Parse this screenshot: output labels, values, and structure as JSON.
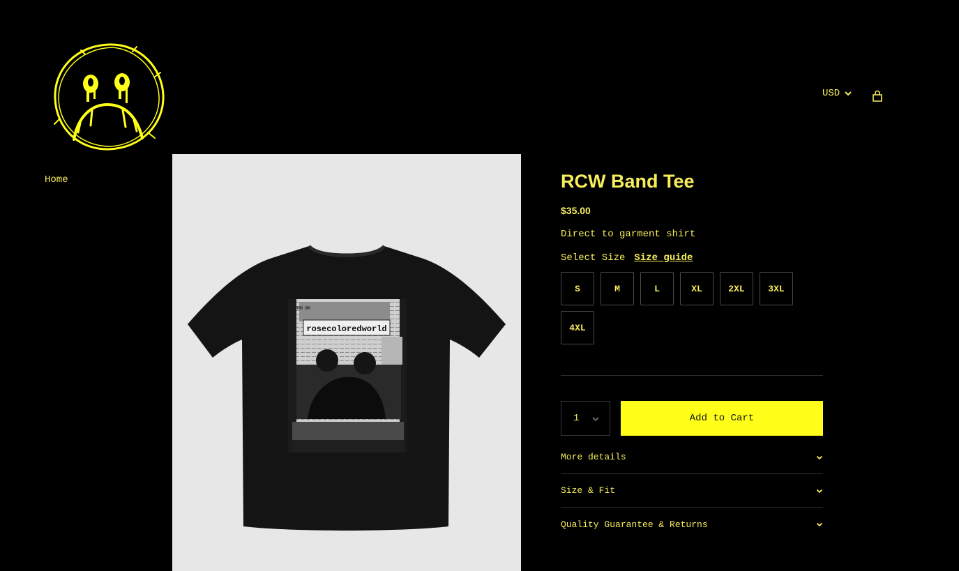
{
  "header": {
    "currency": "USD",
    "logo_name": "sad-face-logo",
    "cart_icon": "cart-bag-icon"
  },
  "nav": {
    "home": "Home"
  },
  "product": {
    "title": "RCW Band Tee",
    "price": "$35.00",
    "description": "Direct to garment shirt",
    "select_size_label": "Select Size",
    "size_guide_label": "Size guide",
    "sizes": [
      "S",
      "M",
      "L",
      "XL",
      "2XL",
      "3XL",
      "4XL"
    ],
    "quantity": "1",
    "add_to_cart": "Add to Cart",
    "shirt_print_text": "rosecoloredworld",
    "accordions": [
      "More details",
      "Size & Fit",
      "Quality Guarantee & Returns"
    ]
  },
  "colors": {
    "background": "#000000",
    "accent_text": "#f7ee5c",
    "button": "#ffff1a",
    "image_bg": "#e7e7e7"
  }
}
